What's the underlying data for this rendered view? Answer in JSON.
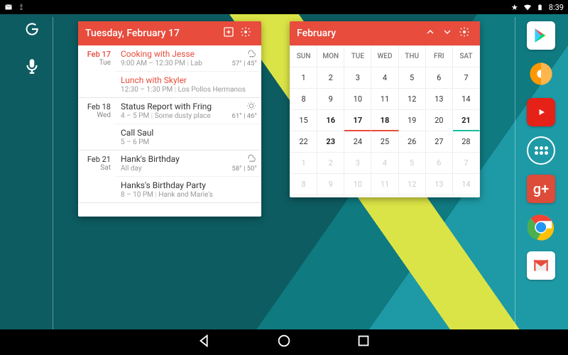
{
  "status_bar": {
    "time": "8:39"
  },
  "left_col": {
    "google_icon": "g-icon",
    "mic_icon": "mic-icon"
  },
  "dock": [
    {
      "name": "play-store"
    },
    {
      "name": "play-music"
    },
    {
      "name": "youtube"
    },
    {
      "name": "app-drawer"
    },
    {
      "name": "google-plus"
    },
    {
      "name": "chrome"
    },
    {
      "name": "gmail"
    }
  ],
  "agenda": {
    "title": "Tuesday, February 17",
    "days": [
      {
        "date_label": "Feb 17",
        "dow": "Tue",
        "today": true,
        "events": [
          {
            "title": "Cooking with Jesse",
            "time": "9:00 AM – 12:30 PM",
            "loc": "Lab",
            "red": true,
            "weather": {
              "icon": "cloud-rain",
              "temps": "57° | 45°"
            }
          },
          {
            "title": "Lunch with Skyler",
            "time": "12:30 – 1:30 PM",
            "loc": "Los Pollos Hermanos",
            "red": true
          }
        ]
      },
      {
        "date_label": "Feb 18",
        "dow": "Wed",
        "today": false,
        "events": [
          {
            "title": "Status Report with Fring",
            "time": "4 – 5 PM",
            "loc": "Some dusty place",
            "weather": {
              "icon": "sun",
              "temps": "61° | 46°"
            }
          },
          {
            "title": "Call Saul",
            "time": "5 – 6 PM"
          }
        ]
      },
      {
        "date_label": "Feb 21",
        "dow": "Sat",
        "today": false,
        "events": [
          {
            "title": "Hank's Birthday",
            "time": "All day",
            "weather": {
              "icon": "rain",
              "temps": "58° | 50°"
            }
          },
          {
            "title": "Hanks's Birthday Party",
            "time": "8 – 10 PM",
            "loc": "Hank and Marie's"
          }
        ]
      }
    ]
  },
  "month": {
    "title": "February",
    "dow": [
      "SUN",
      "MON",
      "TUE",
      "WED",
      "THU",
      "FRI",
      "SAT"
    ],
    "weeks": [
      [
        {
          "n": 1
        },
        {
          "n": 2
        },
        {
          "n": 3
        },
        {
          "n": 4
        },
        {
          "n": 5
        },
        {
          "n": 6
        },
        {
          "n": 7
        }
      ],
      [
        {
          "n": 8
        },
        {
          "n": 9
        },
        {
          "n": 10
        },
        {
          "n": 11
        },
        {
          "n": 12
        },
        {
          "n": 13
        },
        {
          "n": 14
        }
      ],
      [
        {
          "n": 15
        },
        {
          "n": 16,
          "bold": true
        },
        {
          "n": 17,
          "bold": true,
          "mark": "r"
        },
        {
          "n": 18,
          "bold": true,
          "mark": "r"
        },
        {
          "n": 19
        },
        {
          "n": 20
        },
        {
          "n": 21,
          "bold": true,
          "mark": "g"
        }
      ],
      [
        {
          "n": 22
        },
        {
          "n": 23,
          "bold": true
        },
        {
          "n": 24
        },
        {
          "n": 25
        },
        {
          "n": 26
        },
        {
          "n": 27
        },
        {
          "n": 28
        }
      ],
      [
        {
          "n": 1,
          "other": true
        },
        {
          "n": 2,
          "other": true
        },
        {
          "n": 3,
          "other": true
        },
        {
          "n": 4,
          "other": true
        },
        {
          "n": 5,
          "other": true
        },
        {
          "n": 6,
          "other": true
        },
        {
          "n": 7,
          "other": true
        }
      ],
      [
        {
          "n": 8,
          "other": true
        },
        {
          "n": 9,
          "other": true
        },
        {
          "n": 10,
          "other": true
        },
        {
          "n": 11,
          "other": true
        },
        {
          "n": 12,
          "other": true
        },
        {
          "n": 13,
          "other": true
        },
        {
          "n": 14,
          "other": true
        }
      ]
    ]
  }
}
